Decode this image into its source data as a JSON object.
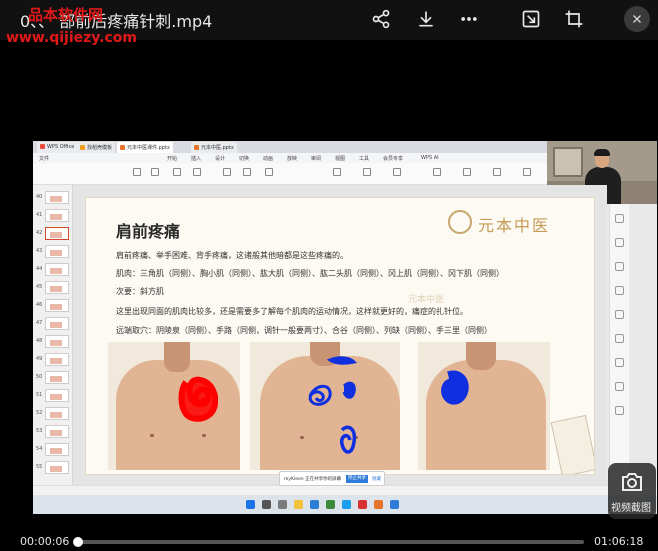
{
  "player": {
    "title": "0、、 部前后疼痛针刺.mp4",
    "watermark_name": "品本软件网",
    "watermark_url": "www.qijiezy.com",
    "time_current": "00:00:06",
    "time_total": "01:06:18",
    "progress": 0.0015,
    "screenshot_label": "视频截图",
    "icons": [
      "share-icon",
      "download-icon",
      "more-icon",
      "pip-icon",
      "crop-icon",
      "close-icon",
      "chevron-right-icon",
      "camera-icon"
    ]
  },
  "wps": {
    "tabs": [
      "WPS Office",
      "找稻壳模板",
      "元本中医课件.pptx",
      "元本中医.pptx"
    ],
    "menu": [
      "文件",
      "开始",
      "插入",
      "设计",
      "切换",
      "动画",
      "放映",
      "审阅",
      "视图",
      "工具",
      "会员专享",
      "WPS AI"
    ]
  },
  "slide": {
    "title": "肩前疼痛",
    "logo": "元本中医",
    "watermark": "元本中医",
    "lines": [
      "肩前疼痛、举手困难、背手疼痛，这诸般其他暗都是这些疼痛的。",
      "肌肉：三角肌（同侧）、胸小肌（同侧）、肱大肌（同侧）、肱二头肌（同侧）、冈上肌（同侧）、冈下肌（同侧）",
      "次要：斜方肌",
      "这里出现同面的肌肉比较多，还是需要多了解每个肌肉的运动情况，这样就更好的，痛症的扎针位。",
      "远端取穴：阴陵泉（同侧）、手路（同侧，调针一般要两寸）、合谷（同侧）、列缺（同侧）、手三里（同侧）"
    ]
  },
  "popup": {
    "text": "myKleen 正在共享你的屏幕",
    "stop_label": "停止共享",
    "hide_label": "隐藏"
  },
  "colors": {
    "watermark_red": "#e21818",
    "marker_red": "#ff0000",
    "marker_blue": "#1030e0",
    "logo_gold": "#c59a55"
  }
}
